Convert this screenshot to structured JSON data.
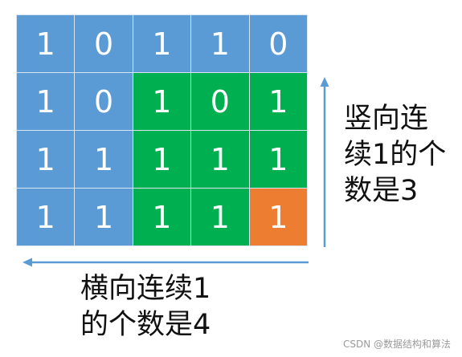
{
  "colors": {
    "blue": "#5b9bd5",
    "green": "#00b050",
    "orange": "#ed7d31",
    "arrow": "#5b9bd5",
    "grid_line": "#d9e4f2"
  },
  "grid": {
    "rows": [
      [
        {
          "value": "1",
          "color": "blue"
        },
        {
          "value": "0",
          "color": "blue"
        },
        {
          "value": "1",
          "color": "blue"
        },
        {
          "value": "1",
          "color": "blue"
        },
        {
          "value": "0",
          "color": "blue"
        }
      ],
      [
        {
          "value": "1",
          "color": "blue"
        },
        {
          "value": "0",
          "color": "blue"
        },
        {
          "value": "1",
          "color": "green"
        },
        {
          "value": "0",
          "color": "green"
        },
        {
          "value": "1",
          "color": "green"
        }
      ],
      [
        {
          "value": "1",
          "color": "blue"
        },
        {
          "value": "1",
          "color": "blue"
        },
        {
          "value": "1",
          "color": "green"
        },
        {
          "value": "1",
          "color": "green"
        },
        {
          "value": "1",
          "color": "green"
        }
      ],
      [
        {
          "value": "1",
          "color": "blue"
        },
        {
          "value": "1",
          "color": "blue"
        },
        {
          "value": "1",
          "color": "green"
        },
        {
          "value": "1",
          "color": "green"
        },
        {
          "value": "1",
          "color": "orange"
        }
      ]
    ]
  },
  "annotations": {
    "vertical": {
      "lines": [
        "竖向连",
        "续1的个",
        "数是3"
      ],
      "arrow_direction": "up"
    },
    "horizontal": {
      "lines": [
        "横向连续1",
        "的个数是4"
      ],
      "arrow_direction": "left"
    }
  },
  "watermark": "CSDN @数据结构和算法"
}
